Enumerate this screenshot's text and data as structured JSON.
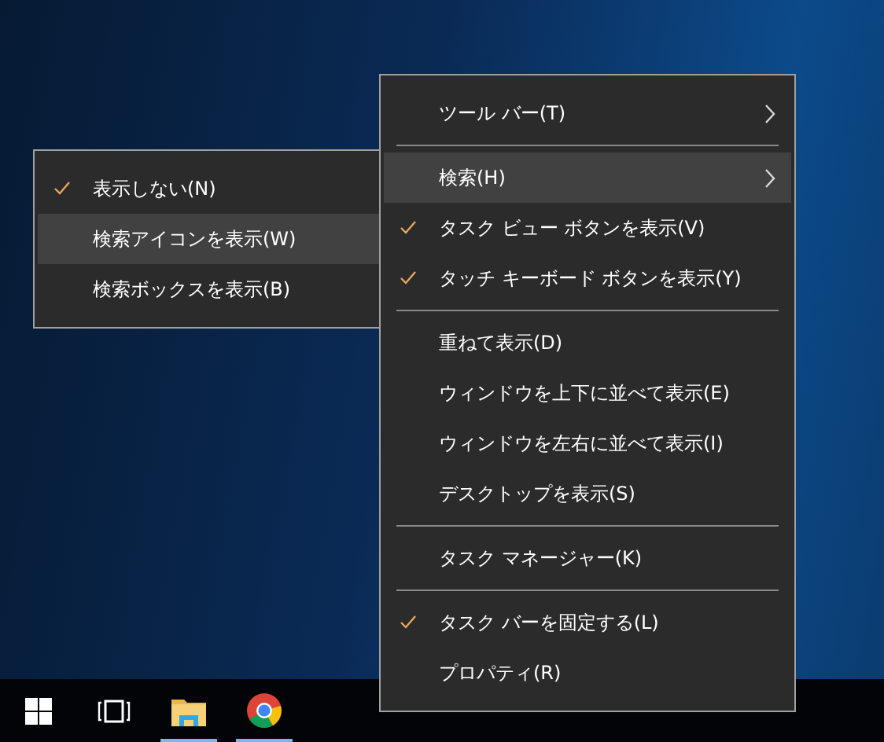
{
  "context_menu": {
    "items": [
      {
        "kind": "item",
        "label": "ツール バー(T)",
        "submenu": true,
        "checked": false,
        "selected": false
      },
      {
        "kind": "separator"
      },
      {
        "kind": "item",
        "label": "検索(H)",
        "submenu": true,
        "checked": false,
        "selected": true
      },
      {
        "kind": "item",
        "label": "タスク ビュー ボタンを表示(V)",
        "submenu": false,
        "checked": true,
        "selected": false
      },
      {
        "kind": "item",
        "label": "タッチ キーボード ボタンを表示(Y)",
        "submenu": false,
        "checked": true,
        "selected": false
      },
      {
        "kind": "separator"
      },
      {
        "kind": "item",
        "label": "重ねて表示(D)",
        "submenu": false,
        "checked": false,
        "selected": false
      },
      {
        "kind": "item",
        "label": "ウィンドウを上下に並べて表示(E)",
        "submenu": false,
        "checked": false,
        "selected": false
      },
      {
        "kind": "item",
        "label": "ウィンドウを左右に並べて表示(I)",
        "submenu": false,
        "checked": false,
        "selected": false
      },
      {
        "kind": "item",
        "label": "デスクトップを表示(S)",
        "submenu": false,
        "checked": false,
        "selected": false
      },
      {
        "kind": "separator"
      },
      {
        "kind": "item",
        "label": "タスク マネージャー(K)",
        "submenu": false,
        "checked": false,
        "selected": false
      },
      {
        "kind": "separator"
      },
      {
        "kind": "item",
        "label": "タスク バーを固定する(L)",
        "submenu": false,
        "checked": true,
        "selected": false
      },
      {
        "kind": "item",
        "label": "プロパティ(R)",
        "submenu": false,
        "checked": false,
        "selected": false
      }
    ]
  },
  "search_submenu": {
    "items": [
      {
        "kind": "item",
        "label": "表示しない(N)",
        "submenu": false,
        "checked": true,
        "selected": false
      },
      {
        "kind": "item",
        "label": "検索アイコンを表示(W)",
        "submenu": false,
        "checked": false,
        "selected": true
      },
      {
        "kind": "item",
        "label": "検索ボックスを表示(B)",
        "submenu": false,
        "checked": false,
        "selected": false
      }
    ]
  },
  "taskbar": {
    "items": [
      {
        "kind": "start",
        "running": false
      },
      {
        "kind": "task-view",
        "running": false
      },
      {
        "kind": "folder",
        "running": true
      },
      {
        "kind": "browser",
        "running": true
      }
    ]
  }
}
